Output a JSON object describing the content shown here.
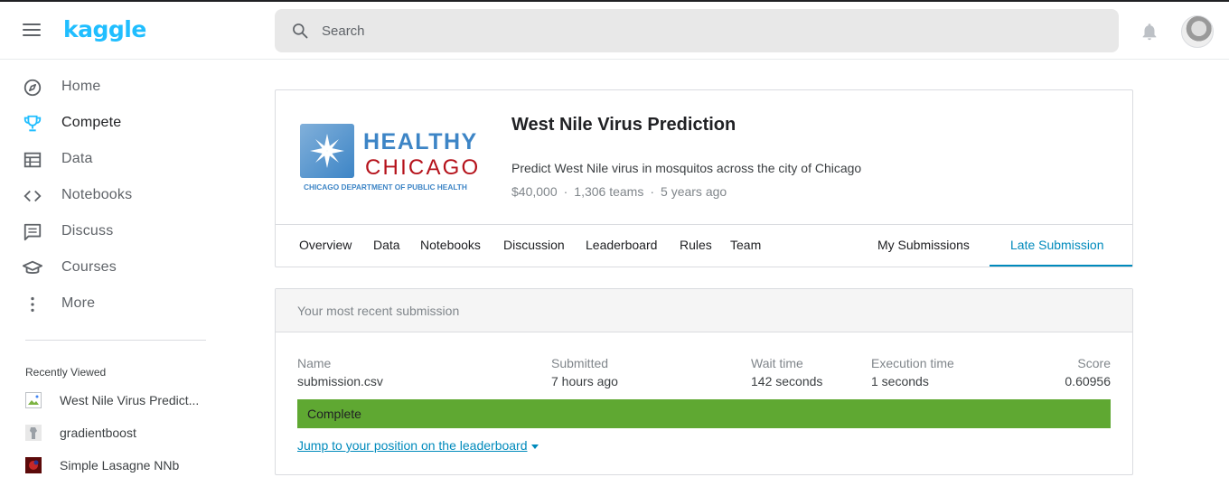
{
  "header": {
    "logo": "kaggle",
    "search_placeholder": "Search"
  },
  "sidebar": {
    "items": [
      {
        "label": "Home",
        "icon": "compass-icon",
        "active": false
      },
      {
        "label": "Compete",
        "icon": "trophy-icon",
        "active": true
      },
      {
        "label": "Data",
        "icon": "table-icon",
        "active": false
      },
      {
        "label": "Notebooks",
        "icon": "code-icon",
        "active": false
      },
      {
        "label": "Discuss",
        "icon": "chat-icon",
        "active": false
      },
      {
        "label": "Courses",
        "icon": "graduation-cap-icon",
        "active": false
      },
      {
        "label": "More",
        "icon": "more-vertical-icon",
        "active": false
      }
    ],
    "recently_viewed_title": "Recently Viewed",
    "recently_viewed": [
      {
        "label": "West Nile Virus Predict...",
        "thumb": "broken-image-icon"
      },
      {
        "label": "gradientboost",
        "thumb": "avatar-thumb"
      },
      {
        "label": "Simple Lasagne NNb",
        "thumb": "notebook-thumb"
      }
    ]
  },
  "competition": {
    "logo_line1": "HEALTHY",
    "logo_line2": "CHICAGO",
    "logo_line3": "CHICAGO DEPARTMENT OF PUBLIC HEALTH",
    "title": "West Nile Virus Prediction",
    "description": "Predict West Nile virus in mosquitos across the city of Chicago",
    "prize": "$40,000",
    "teams": "1,306 teams",
    "age": "5 years ago",
    "meta_separator": "·",
    "tabs": [
      "Overview",
      "Data",
      "Notebooks",
      "Discussion",
      "Leaderboard",
      "Rules",
      "Team",
      "My Submissions",
      "Late Submission"
    ],
    "active_tab": "Late Submission"
  },
  "submission": {
    "header": "Your most recent submission",
    "columns": {
      "name": {
        "label": "Name",
        "value": "submission.csv"
      },
      "submitted": {
        "label": "Submitted",
        "value": "7 hours ago"
      },
      "wait_time": {
        "label": "Wait time",
        "value": "142 seconds"
      },
      "execution_time": {
        "label": "Execution time",
        "value": "1 seconds"
      },
      "score": {
        "label": "Score",
        "value": "0.60956"
      }
    },
    "status": "Complete",
    "jump_link": "Jump to your position on the leaderboard"
  },
  "colors": {
    "brand": "#20beff",
    "link": "#008abc",
    "complete": "#5fa832",
    "logo_blue": "#3d85c6",
    "logo_red": "#b5121b"
  }
}
